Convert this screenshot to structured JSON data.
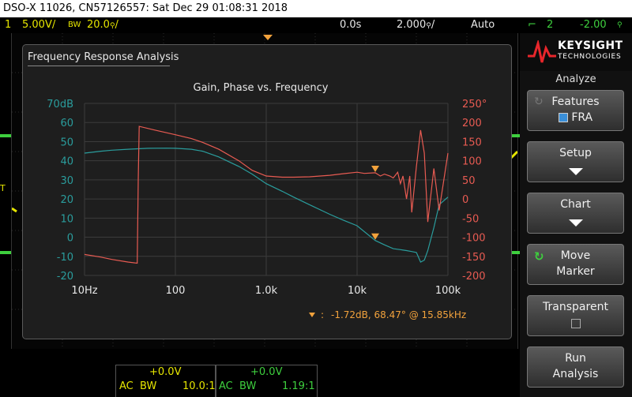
{
  "titlebar": {
    "text": "DSO-X 11026, CN57126557: Sat Dec 29 01:08:31 2018"
  },
  "status": {
    "ch1_num": "1",
    "ch1_scale": "5.00V/",
    "bw_label": "BW",
    "bw_value": "20.0",
    "bw_suffix": "/",
    "time_pos": "0.0s",
    "time_scale": "2.000",
    "time_suffix": "/",
    "trigger_mode": "Auto",
    "trig_ch": "2",
    "trig_level": "-2.00"
  },
  "bottom": {
    "ch1_offset": "+0.0V",
    "ch1_coupling": "AC",
    "ch1_bw": "BW",
    "ch1_probe": "10.0:1",
    "ch2_offset": "+0.0V",
    "ch2_coupling": "AC",
    "ch2_bw": "BW",
    "ch2_probe": "1.19:1"
  },
  "panel": {
    "brand": "KEYSIGHT",
    "brand_sub": "TECHNOLOGIES",
    "menu_title": "Analyze",
    "features_label": "Features",
    "features_value": "FRA",
    "setup_label": "Setup",
    "chart_label": "Chart",
    "move_label_1": "Move",
    "move_label_2": "Marker",
    "transparent_label": "Transparent",
    "run_label_1": "Run",
    "run_label_2": "Analysis"
  },
  "dialog": {
    "title": "Frequency Response Analysis"
  },
  "colors": {
    "gain": "#2a9d9d",
    "phase": "#e85b52",
    "marker": "#f2a23c",
    "ch1": "#e6e600",
    "ch2": "#3ecf3e"
  },
  "chart_data": {
    "type": "line",
    "title": "Gain, Phase vs. Frequency",
    "x_scale": "log",
    "xlim": [
      10,
      100000
    ],
    "x_ticks": [
      "10Hz",
      "100",
      "1.0k",
      "10k",
      "100k"
    ],
    "y_left_ticks": [
      "70dB",
      "60",
      "50",
      "40",
      "30",
      "20",
      "10",
      "0",
      "-10",
      "-20"
    ],
    "y_left_lim": [
      -20,
      70
    ],
    "y_right_ticks": [
      "250°",
      "200",
      "150",
      "100",
      "50",
      "0",
      "-50",
      "-100",
      "-150",
      "-200"
    ],
    "y_right_lim": [
      -200,
      250
    ],
    "series": [
      {
        "axis": "left",
        "x": [
          10,
          15,
          20,
          30,
          50,
          80,
          100,
          150,
          200,
          300,
          500,
          700,
          1000,
          1500,
          2000,
          3000,
          5000,
          7000,
          10000,
          15850,
          20000,
          25000,
          30000,
          35000,
          40000,
          45000,
          50000,
          55000,
          60000,
          70000,
          80000,
          100000
        ],
        "y": [
          44,
          45,
          45.5,
          46,
          46.5,
          46.6,
          46.5,
          46,
          45,
          42,
          37,
          33,
          28,
          24,
          21,
          17,
          12,
          9,
          6,
          -1.72,
          -4,
          -6,
          -6.5,
          -7,
          -7.5,
          -8,
          -13,
          -12,
          -7,
          5,
          17,
          21
        ]
      },
      {
        "axis": "right",
        "x": [
          10,
          15,
          20,
          30,
          38,
          39,
          40,
          60,
          100,
          150,
          200,
          300,
          500,
          700,
          1000,
          1500,
          2000,
          3000,
          5000,
          7000,
          10000,
          12000,
          15850,
          18000,
          20000,
          23000,
          25000,
          28000,
          30000,
          32000,
          35000,
          38000,
          40000,
          45000,
          50000,
          55000,
          60000,
          70000,
          80000,
          100000
        ],
        "y": [
          -145,
          -152,
          -158,
          -165,
          -168,
          50,
          190,
          180,
          168,
          158,
          148,
          130,
          100,
          75,
          60,
          57,
          57,
          58,
          62,
          66,
          70,
          67,
          68.47,
          60,
          65,
          60,
          55,
          70,
          40,
          60,
          0,
          60,
          -35,
          85,
          180,
          120,
          -60,
          80,
          -30,
          120
        ]
      }
    ],
    "marker_readout": "-1.72dB, 68.47° @ 15.85kHz",
    "marker_sep": ":"
  }
}
